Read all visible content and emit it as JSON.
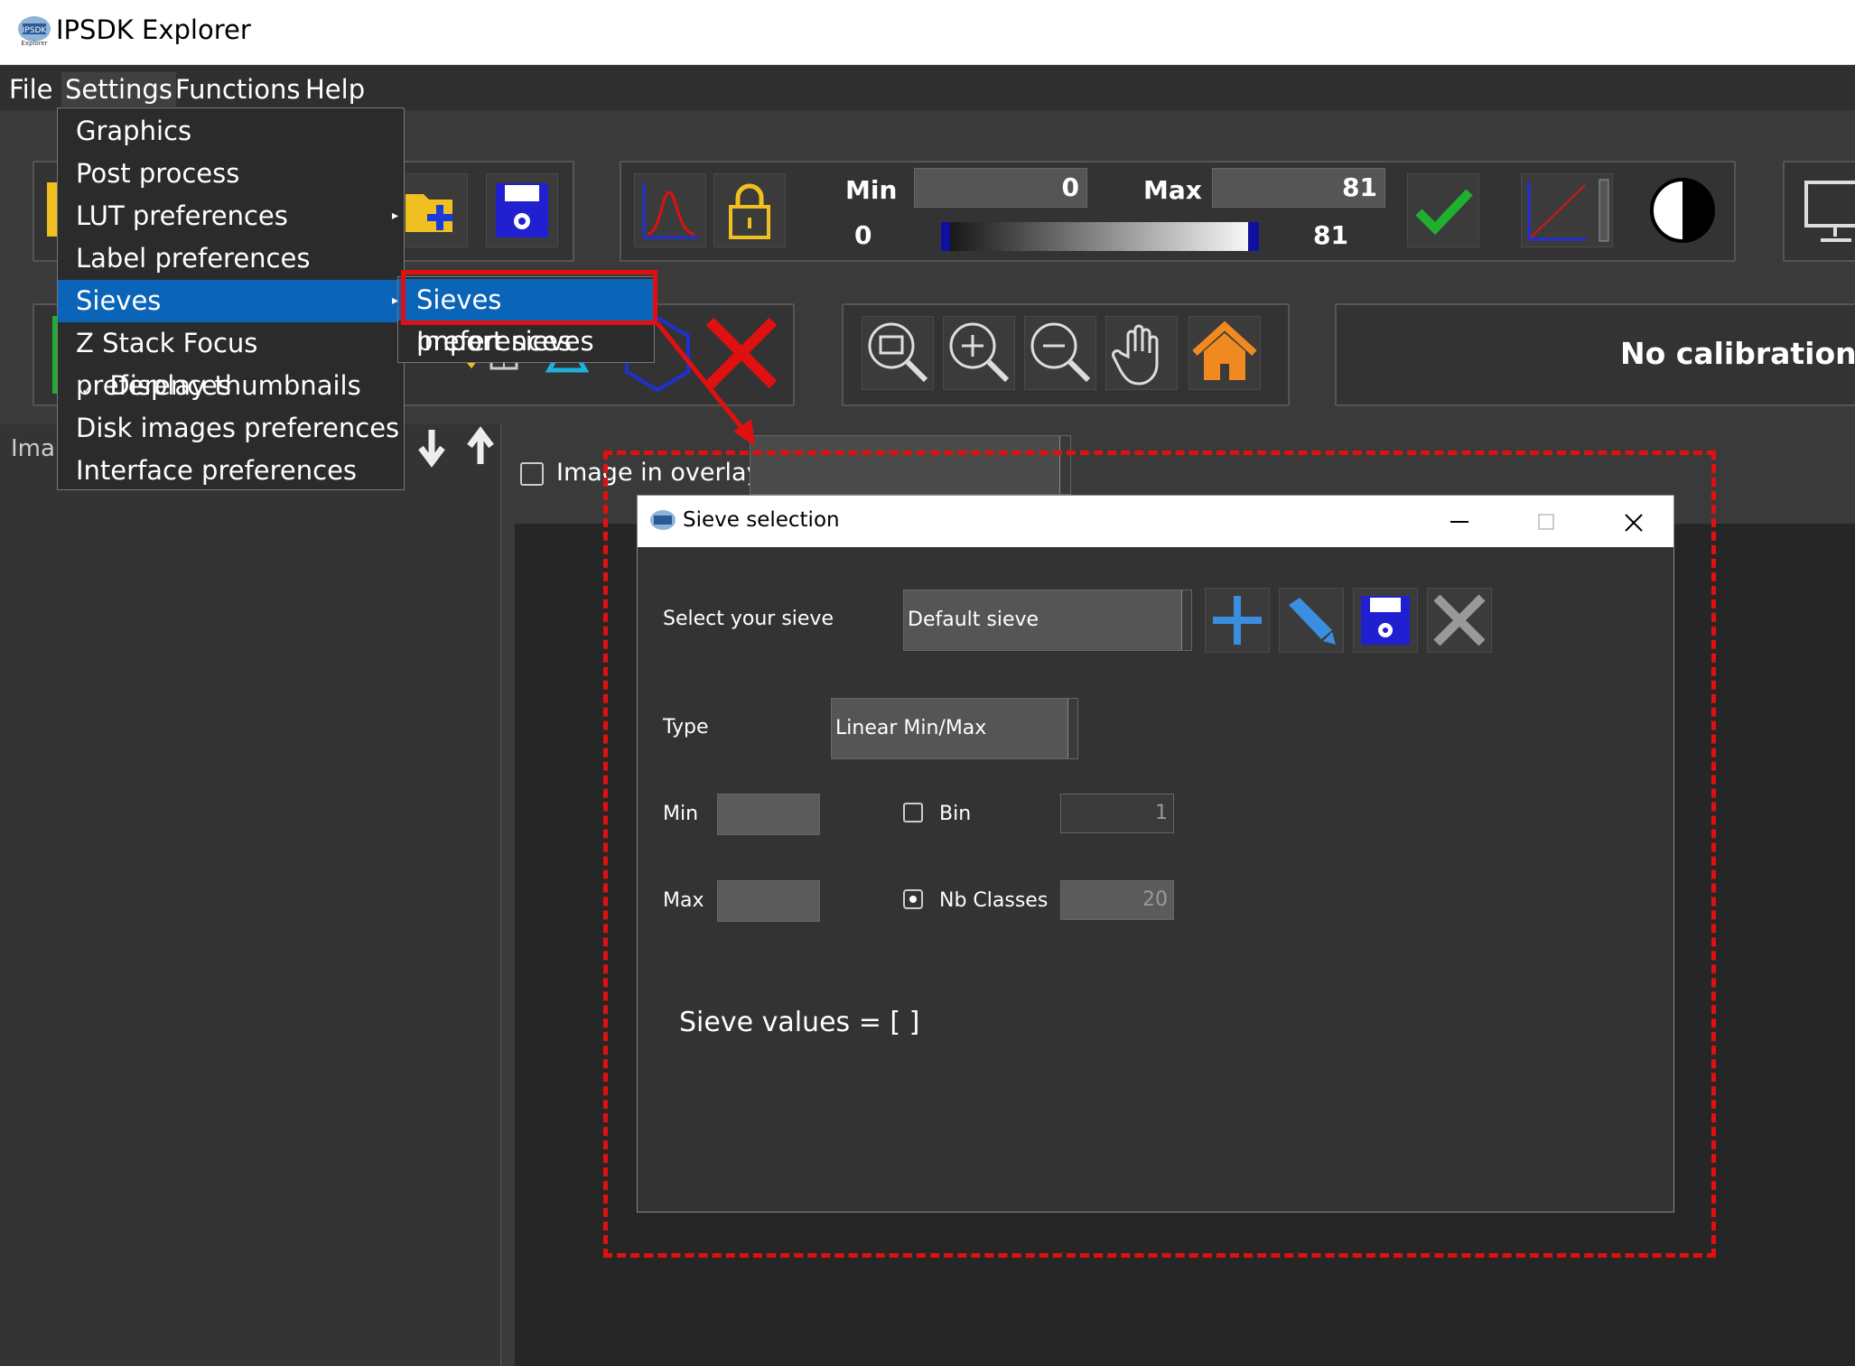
{
  "app": {
    "title": "IPSDK Explorer"
  },
  "menubar": {
    "file": "File",
    "settings": "Settings",
    "functions": "Functions",
    "help": "Help"
  },
  "settings_menu": {
    "items": [
      "Graphics",
      "Post process",
      "LUT preferences",
      "Label preferences",
      "Sieves",
      "Z Stack Focus preferences",
      "Display thumbnails",
      "Disk images preferences",
      "Interface preferences"
    ],
    "checked_mark": "✓"
  },
  "sieves_submenu": {
    "items": [
      "Sieves preferences",
      "Import sieves"
    ]
  },
  "lut": {
    "min_label": "Min",
    "min_value": "0",
    "max_label": "Max",
    "max_value": "81",
    "range_min": "0",
    "range_max": "81"
  },
  "calibration": {
    "text": "No calibration"
  },
  "left_panel": {
    "label": "Ima"
  },
  "overlay": {
    "label": "Image in overlay"
  },
  "dialog": {
    "title": "Sieve selection",
    "select_label": "Select your sieve",
    "sieve_value": "Default sieve",
    "type_label": "Type",
    "type_value": "Linear Min/Max",
    "min_label": "Min",
    "max_label": "Max",
    "bin_label": "Bin",
    "bin_value": "1",
    "nb_classes_label": "Nb Classes",
    "nb_classes_value": "20",
    "sieve_values": "Sieve values = [ ]"
  },
  "colors": {
    "accent_red": "#e01010",
    "highlight_blue": "#0a64b8",
    "save_blue": "#2020d0"
  }
}
